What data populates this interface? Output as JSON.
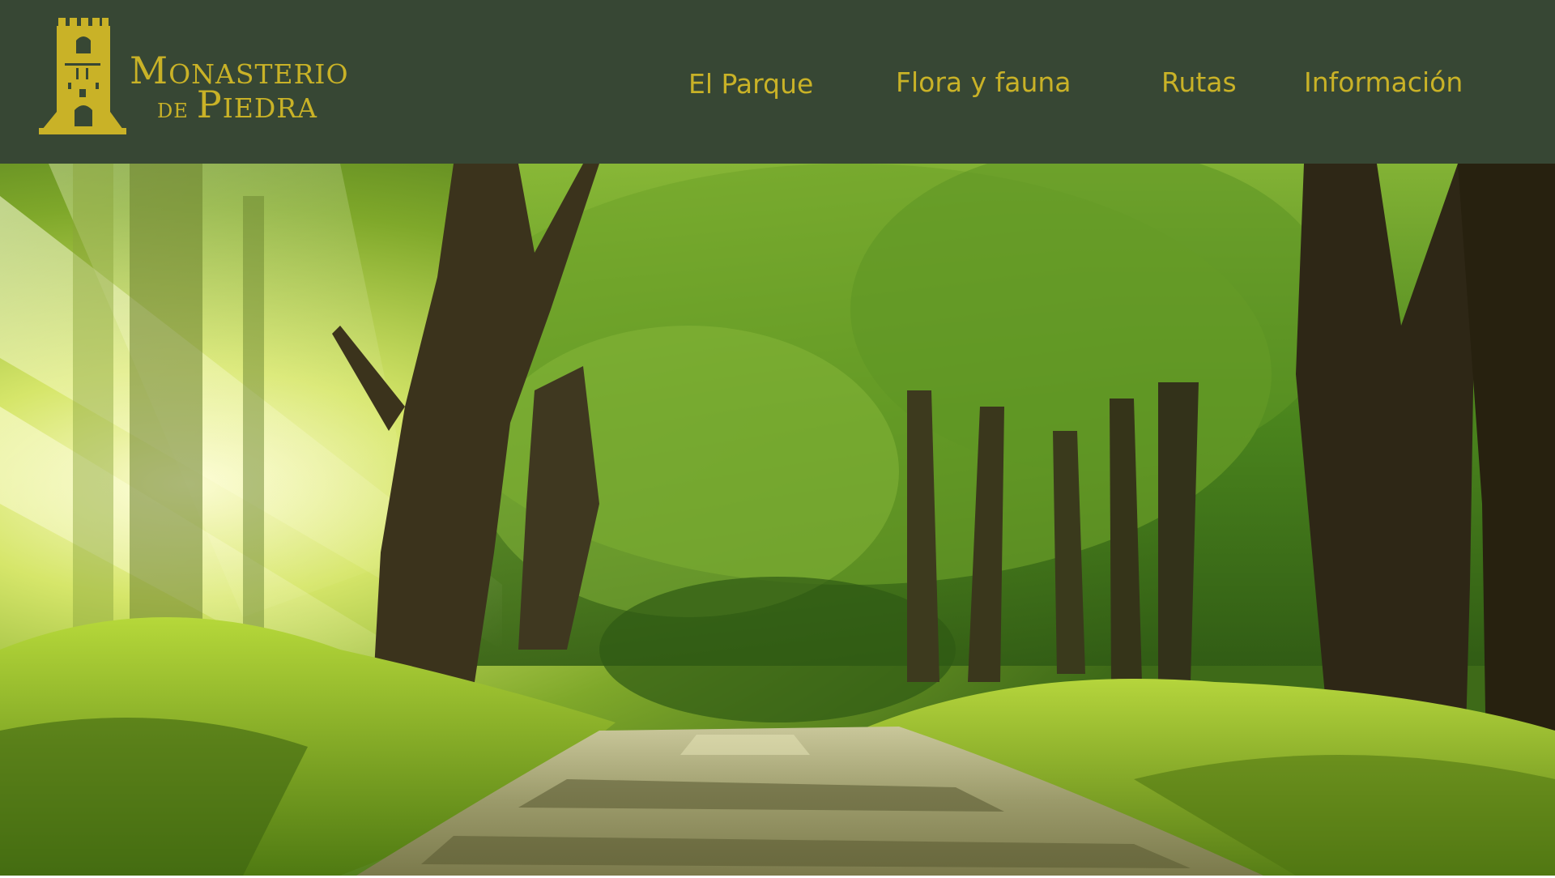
{
  "site": {
    "name_line1": "Monasterio",
    "name_line2_prefix": "de",
    "name_line2": "Piedra",
    "logo_icon": "tower-icon"
  },
  "nav": {
    "items": [
      {
        "label": "El Parque"
      },
      {
        "label": "Flora y fauna"
      },
      {
        "label": "Rutas"
      },
      {
        "label": "Información"
      }
    ]
  },
  "hero": {
    "image_icon": "forest-road-photo"
  },
  "colors": {
    "header_bg": "#374734",
    "accent_gold": "#c9b227"
  }
}
